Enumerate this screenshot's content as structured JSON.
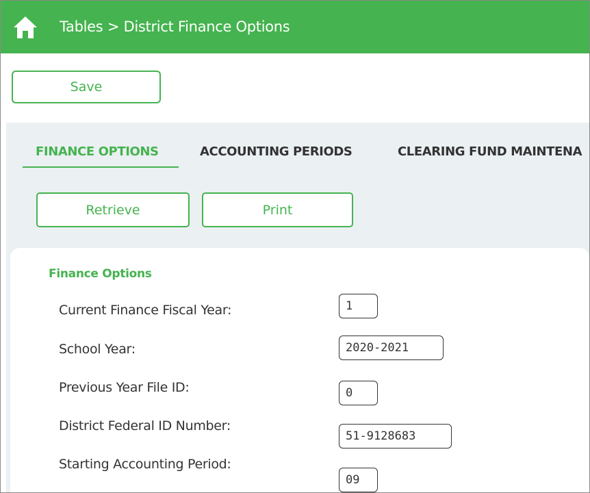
{
  "header": {
    "breadcrumb": "Tables > District Finance Options"
  },
  "toolbar": {
    "save_label": "Save"
  },
  "tabs": [
    {
      "label": "FINANCE OPTIONS",
      "active": true
    },
    {
      "label": "ACCOUNTING PERIODS",
      "active": false
    },
    {
      "label": "CLEARING FUND MAINTENA",
      "active": false
    }
  ],
  "actions": {
    "retrieve_label": "Retrieve",
    "print_label": "Print"
  },
  "panel": {
    "heading": "Finance Options",
    "fields": [
      {
        "label": "Current Finance Fiscal Year:",
        "value": "1"
      },
      {
        "label": "School Year:",
        "value": "2020-2021"
      },
      {
        "label": "Previous Year File ID:",
        "value": "0"
      },
      {
        "label": "District Federal ID Number:",
        "value": "51-9128683"
      },
      {
        "label": "Starting Accounting Period:",
        "value": "09"
      }
    ]
  },
  "colors": {
    "accent": "#45b34f",
    "content_background": "#ebf0f3",
    "text": "#333333"
  },
  "icons": {
    "home": "home-icon"
  }
}
